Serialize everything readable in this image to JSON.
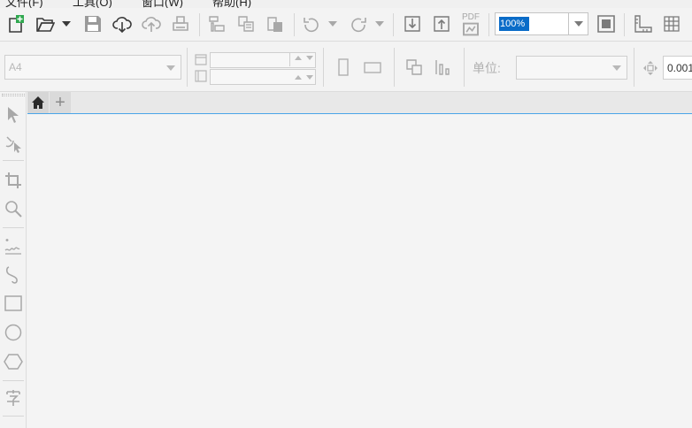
{
  "menu": {
    "file": "文件(F)",
    "tools": "工具(O)",
    "window": "窗口(W)",
    "help": "帮助(H)"
  },
  "toolbar": {
    "zoom_value": "100%",
    "pdf_label": "PDF"
  },
  "properties": {
    "page_size": "A4",
    "unit_label": "单位:",
    "unit_value": "",
    "nudge_value": "0.001"
  },
  "tabs": {
    "add_label": "+"
  },
  "colors": {
    "selection_blue": "#0a6cc8",
    "tab_underline": "#4aa5e8",
    "icon_dark": "#3a3a3a",
    "icon_disabled": "#a8a8a8"
  }
}
